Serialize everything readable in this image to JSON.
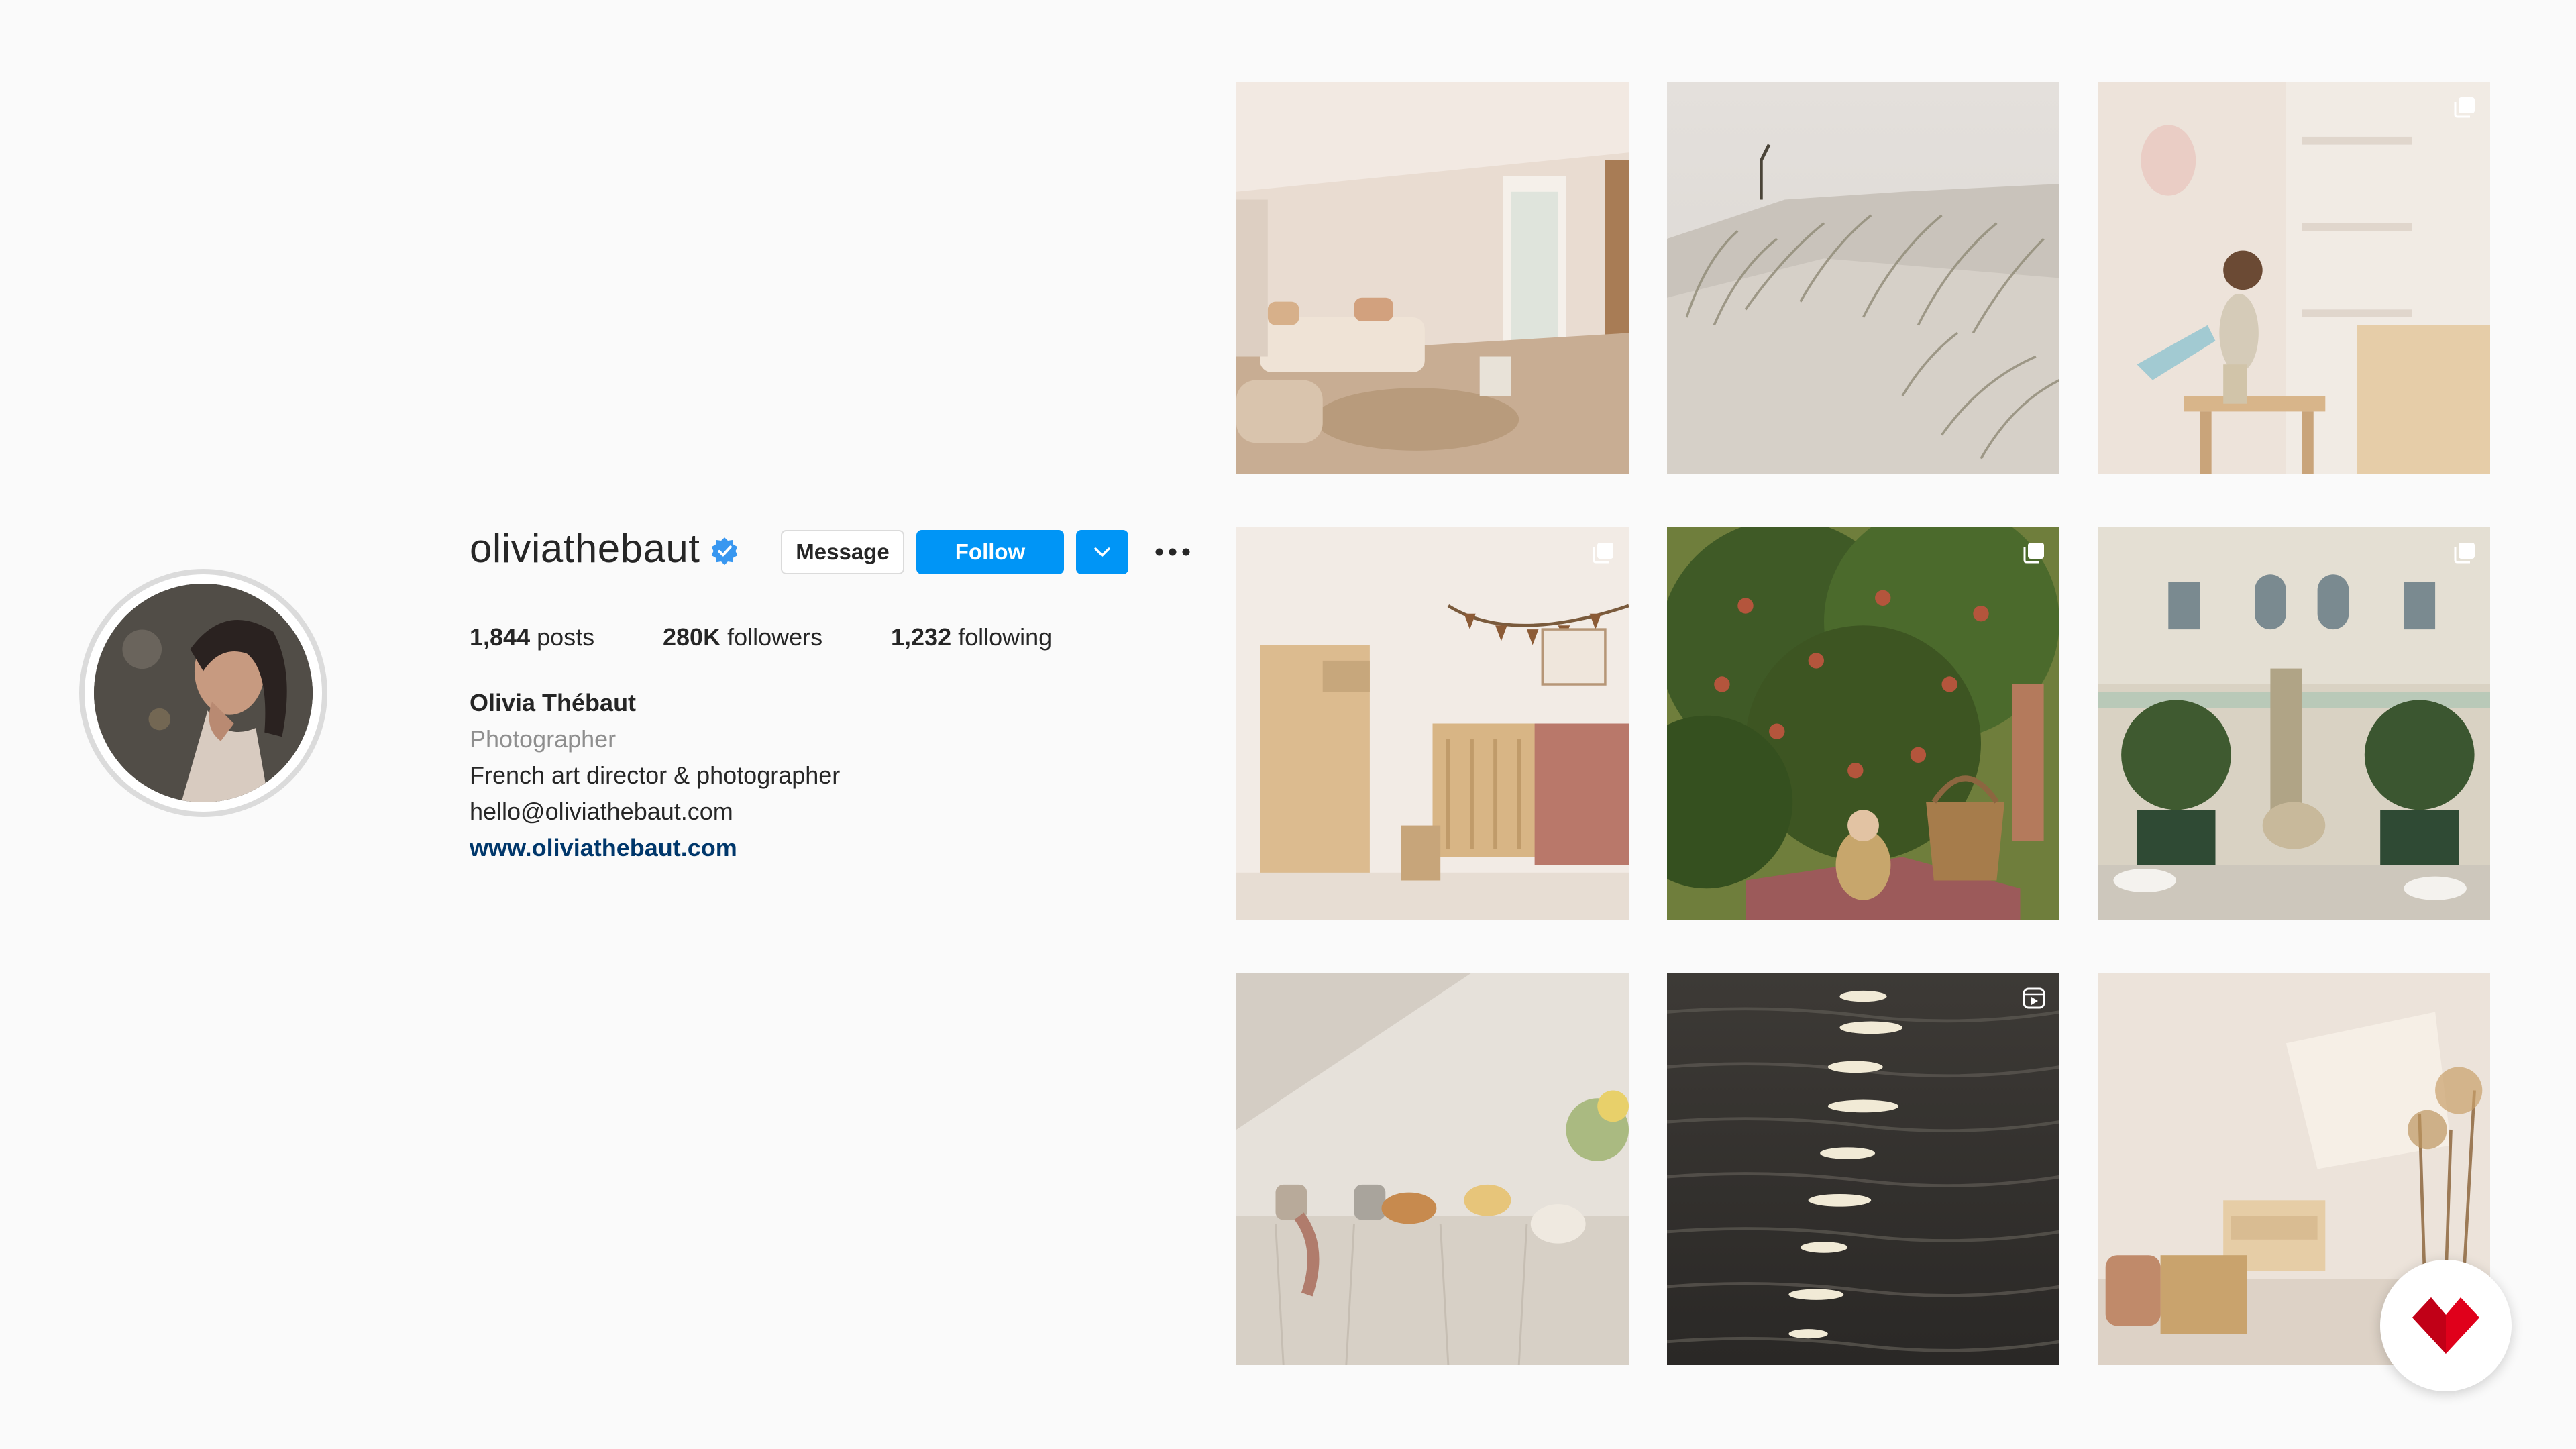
{
  "profile": {
    "username": "oliviathebaut",
    "verified": true,
    "avatar_icon": "profile-photo",
    "buttons": {
      "message": "Message",
      "follow": "Follow",
      "dropdown_icon": "chevron-down-icon",
      "more_icon": "more-options-icon"
    },
    "stats": {
      "posts_count": "1,844",
      "posts_label": "posts",
      "followers_count": "280K",
      "followers_label": "followers",
      "following_count": "1,232",
      "following_label": "following"
    },
    "bio": {
      "name": "Olivia Thébaut",
      "category": "Photographer",
      "description": "French art director & photographer",
      "email": "hello@oliviathebaut.com",
      "website": "www.oliviathebaut.com"
    }
  },
  "posts": [
    {
      "subject": "living room interior",
      "badge": "none"
    },
    {
      "subject": "sand dunes with grass",
      "badge": "none"
    },
    {
      "subject": "child painting on wall",
      "badge": "carousel-icon"
    },
    {
      "subject": "nursery with crib",
      "badge": "carousel-icon"
    },
    {
      "subject": "apple tree with baby",
      "badge": "carousel-icon"
    },
    {
      "subject": "courtyard terrace",
      "badge": "carousel-icon"
    },
    {
      "subject": "breakfast table",
      "badge": "none"
    },
    {
      "subject": "sunlight on water",
      "badge": "reel-icon"
    },
    {
      "subject": "sunlit interior corner",
      "badge": "none"
    }
  ],
  "colors": {
    "background": "#fafafa",
    "primary_blue": "#0095f6",
    "link_blue": "#00376b",
    "verified_blue": "#3897f0",
    "secondary_text": "#8e8e8e",
    "logo_red": "#e0001b"
  }
}
